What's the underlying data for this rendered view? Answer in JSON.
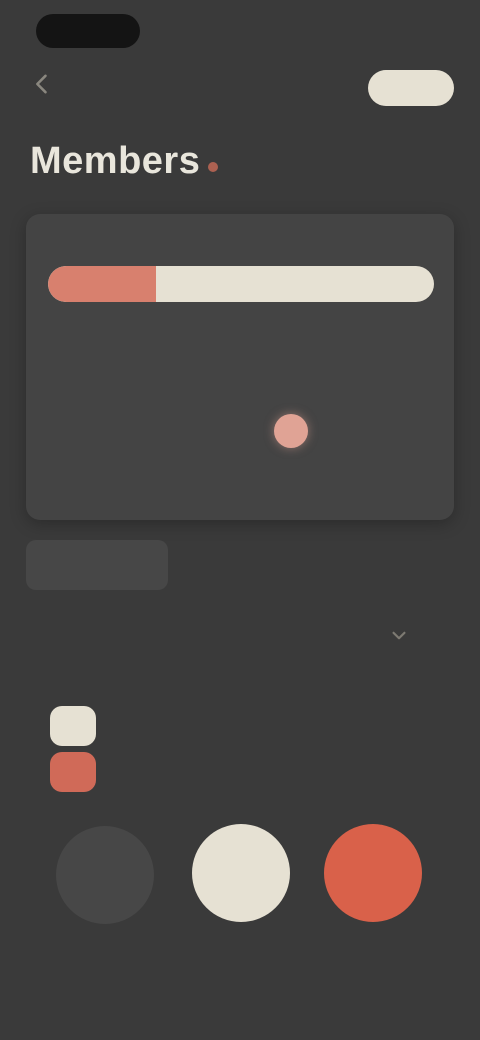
{
  "header": {
    "title": "Members",
    "action_label": ""
  },
  "card": {
    "caption": "",
    "progress_fraction": 0.28,
    "timer": "",
    "sub_label": "",
    "row_text": "",
    "footer_text": ""
  },
  "tabs": [
    "",
    "",
    ""
  ],
  "section": {
    "heading": "",
    "hint": "",
    "legend": [
      "",
      ""
    ]
  },
  "buttons": {
    "left_label": "",
    "middle_label": "",
    "right_label": ""
  },
  "colors": {
    "background": "#3a3a3a",
    "cream": "#e6e1d3",
    "coral": "#d06a58",
    "card": "#444444"
  }
}
